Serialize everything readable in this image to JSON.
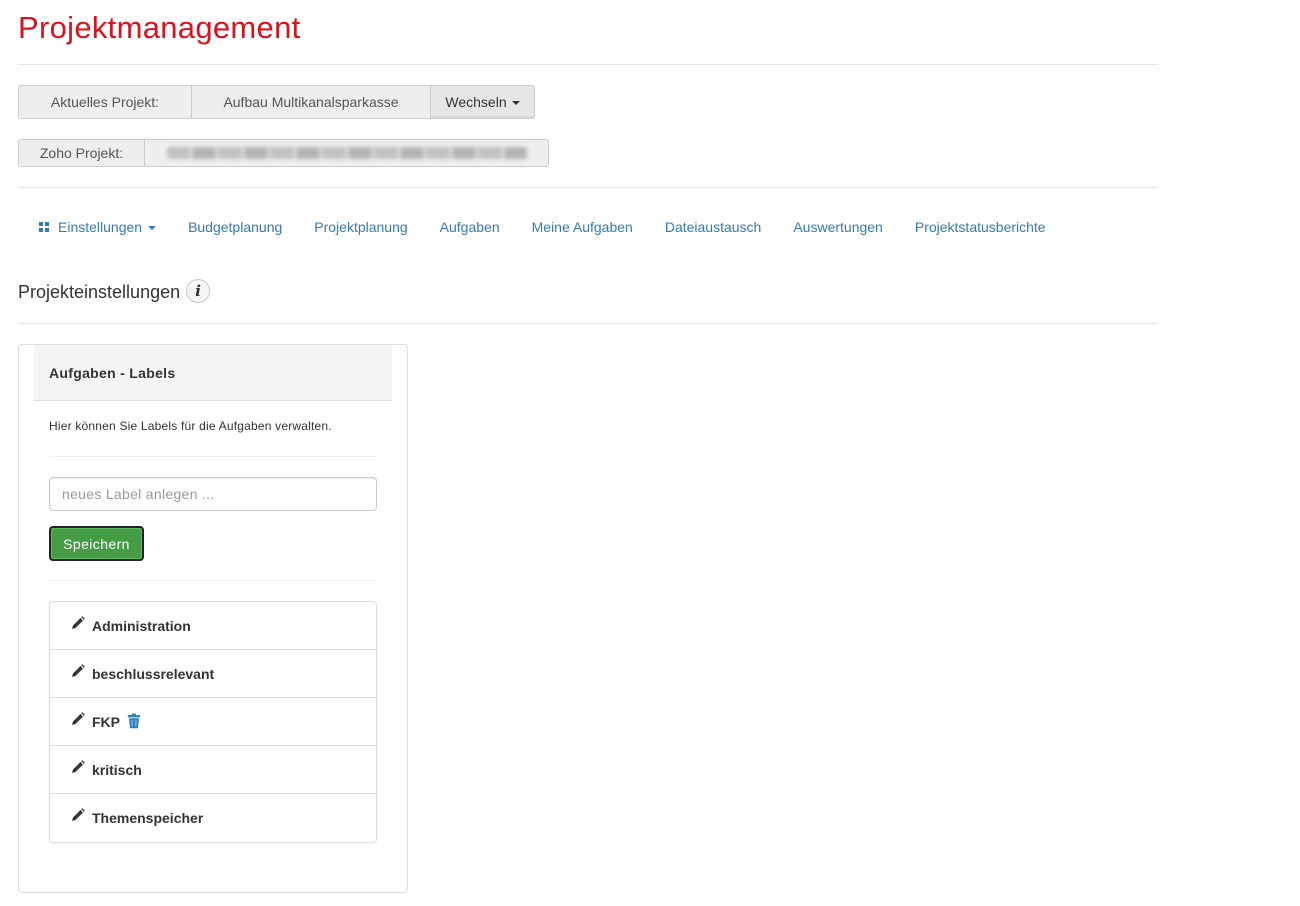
{
  "app": {
    "title": "Projektmanagement",
    "title_color": "#d9121d"
  },
  "project": {
    "current_label": "Aktuelles Projekt:",
    "current_value": "Aufbau Multikanalsparkasse",
    "switch_label": "Wechseln",
    "zoho_label": "Zoho Projekt:"
  },
  "nav": {
    "items": [
      {
        "label": "Einstellungen",
        "icon": "grid-icon",
        "dropdown": true
      },
      {
        "label": "Budgetplanung"
      },
      {
        "label": "Projektplanung"
      },
      {
        "label": "Aufgaben"
      },
      {
        "label": "Meine Aufgaben"
      },
      {
        "label": "Dateiaustausch"
      },
      {
        "label": "Auswertungen"
      },
      {
        "label": "Projektstatusberichte"
      }
    ],
    "link_color": "#337ab7"
  },
  "section": {
    "title": "Projekteinstellungen",
    "info_icon": "info-icon"
  },
  "panel": {
    "heading": "Aufgaben - Labels",
    "description": "Hier können Sie Labels für die Aufgaben verwalten.",
    "input_placeholder": "neues Label anlegen ...",
    "input_value": "",
    "save_label": "Speichern",
    "save_color": "#449d44",
    "labels": [
      {
        "name": "Administration",
        "deletable": false
      },
      {
        "name": "beschlussrelevant",
        "deletable": false
      },
      {
        "name": "FKP",
        "deletable": true
      },
      {
        "name": "kritisch",
        "deletable": false
      },
      {
        "name": "Themenspeicher",
        "deletable": false
      }
    ]
  }
}
